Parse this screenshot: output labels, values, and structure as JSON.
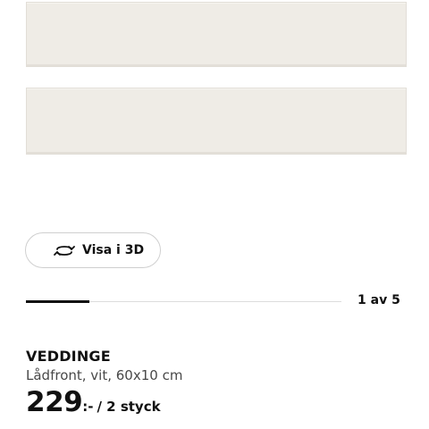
{
  "gallery": {
    "view_3d_label": "Visa i 3D",
    "pager_text": "1 av 5",
    "progress_fraction": 0.2
  },
  "product": {
    "name": "VEDDINGE",
    "description": "Lådfront, vit, 60x10 cm",
    "price": "229",
    "price_suffix": ":-",
    "unit": "/ 2 styck"
  },
  "icons": {
    "view_3d": "rotate-3d-icon"
  },
  "colors": {
    "front": "#efece6",
    "text": "#111111",
    "muted": "#484848",
    "track": "#dcdcdc"
  }
}
